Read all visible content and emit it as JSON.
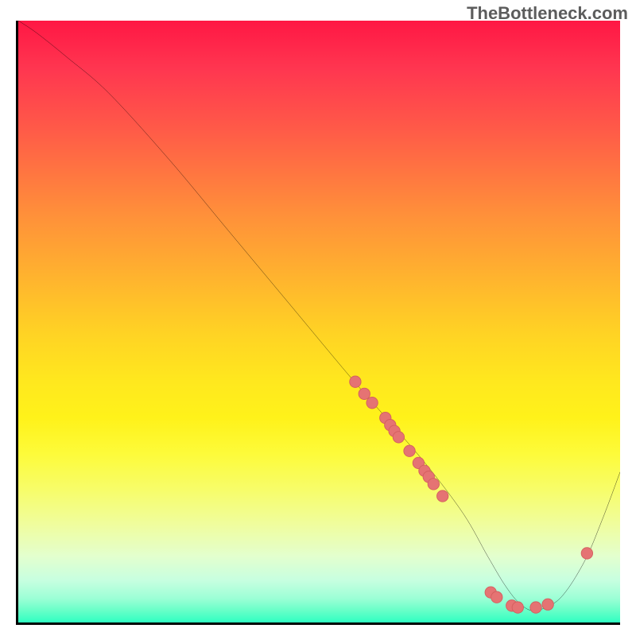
{
  "watermark": "TheBottleneck.com",
  "chart_data": {
    "type": "line",
    "title": "",
    "xlabel": "",
    "ylabel": "",
    "xlim": [
      0,
      100
    ],
    "ylim": [
      0,
      100
    ],
    "grid": false,
    "legend": false,
    "series": [
      {
        "name": "curve",
        "x": [
          0,
          3,
          8,
          15,
          25,
          35,
          45,
          55,
          62,
          68,
          74,
          78,
          81,
          83.5,
          86,
          90,
          94,
          97,
          100
        ],
        "y": [
          100,
          98,
          94,
          88,
          77,
          65,
          53,
          41,
          33,
          26,
          18,
          11,
          6,
          3,
          2,
          4,
          10,
          17,
          25
        ]
      }
    ],
    "markers": [
      {
        "x": 56.0,
        "y": 40.0
      },
      {
        "x": 57.5,
        "y": 38.0
      },
      {
        "x": 58.8,
        "y": 36.5
      },
      {
        "x": 61.0,
        "y": 34.0
      },
      {
        "x": 61.8,
        "y": 32.8
      },
      {
        "x": 62.5,
        "y": 31.8
      },
      {
        "x": 63.2,
        "y": 30.8
      },
      {
        "x": 65.0,
        "y": 28.5
      },
      {
        "x": 66.5,
        "y": 26.5
      },
      {
        "x": 67.5,
        "y": 25.2
      },
      {
        "x": 68.2,
        "y": 24.2
      },
      {
        "x": 69.0,
        "y": 23.0
      },
      {
        "x": 70.5,
        "y": 21.0
      },
      {
        "x": 78.5,
        "y": 5.0
      },
      {
        "x": 79.5,
        "y": 4.2
      },
      {
        "x": 82.0,
        "y": 2.8
      },
      {
        "x": 83.0,
        "y": 2.5
      },
      {
        "x": 86.0,
        "y": 2.5
      },
      {
        "x": 88.0,
        "y": 3.0
      },
      {
        "x": 94.5,
        "y": 11.5
      }
    ],
    "gradient_stops": [
      {
        "pos": 0,
        "color": "#ff1744"
      },
      {
        "pos": 8,
        "color": "#ff3650"
      },
      {
        "pos": 18,
        "color": "#ff5a48"
      },
      {
        "pos": 32,
        "color": "#ff8f3a"
      },
      {
        "pos": 42,
        "color": "#ffb12f"
      },
      {
        "pos": 52,
        "color": "#ffd324"
      },
      {
        "pos": 60,
        "color": "#ffe81e"
      },
      {
        "pos": 66,
        "color": "#fff21a"
      },
      {
        "pos": 72,
        "color": "#fdfb3a"
      },
      {
        "pos": 78,
        "color": "#f7fd6a"
      },
      {
        "pos": 84,
        "color": "#effda0"
      },
      {
        "pos": 89,
        "color": "#e3ffce"
      },
      {
        "pos": 93,
        "color": "#c7ffe0"
      },
      {
        "pos": 96,
        "color": "#9cffd6"
      },
      {
        "pos": 98,
        "color": "#68ffc8"
      },
      {
        "pos": 100,
        "color": "#2fffc2"
      }
    ],
    "marker_style": {
      "shape": "circle",
      "fill": "#e57373",
      "stroke": "#d45f5f",
      "r": 7
    }
  }
}
